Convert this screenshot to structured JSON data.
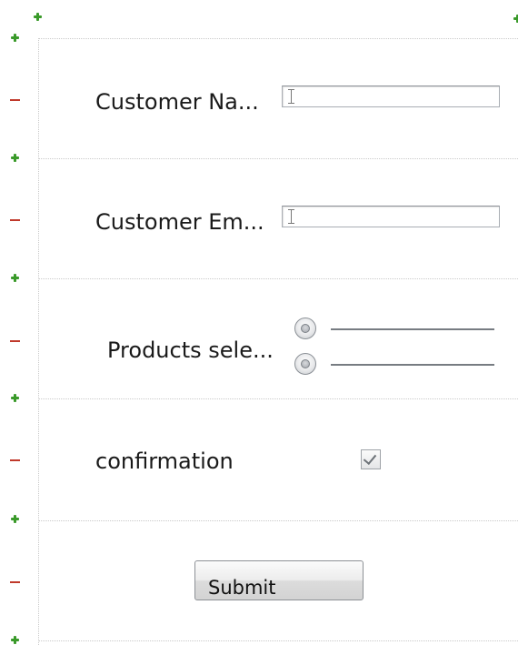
{
  "form": {
    "customer_name_label": "Customer Na...",
    "customer_email_label": "Customer Em...",
    "products_label": "Products sele...",
    "confirmation_label": "confirmation",
    "confirmation_checked": true,
    "submit_label": "Submit"
  },
  "colors": {
    "add_marker": "#3a9a2a",
    "remove_marker": "#c0392b"
  },
  "icons": {
    "add_row": "plus-icon",
    "remove_row": "minus-icon",
    "text_cursor": "text-cursor-icon",
    "check": "check-icon"
  }
}
